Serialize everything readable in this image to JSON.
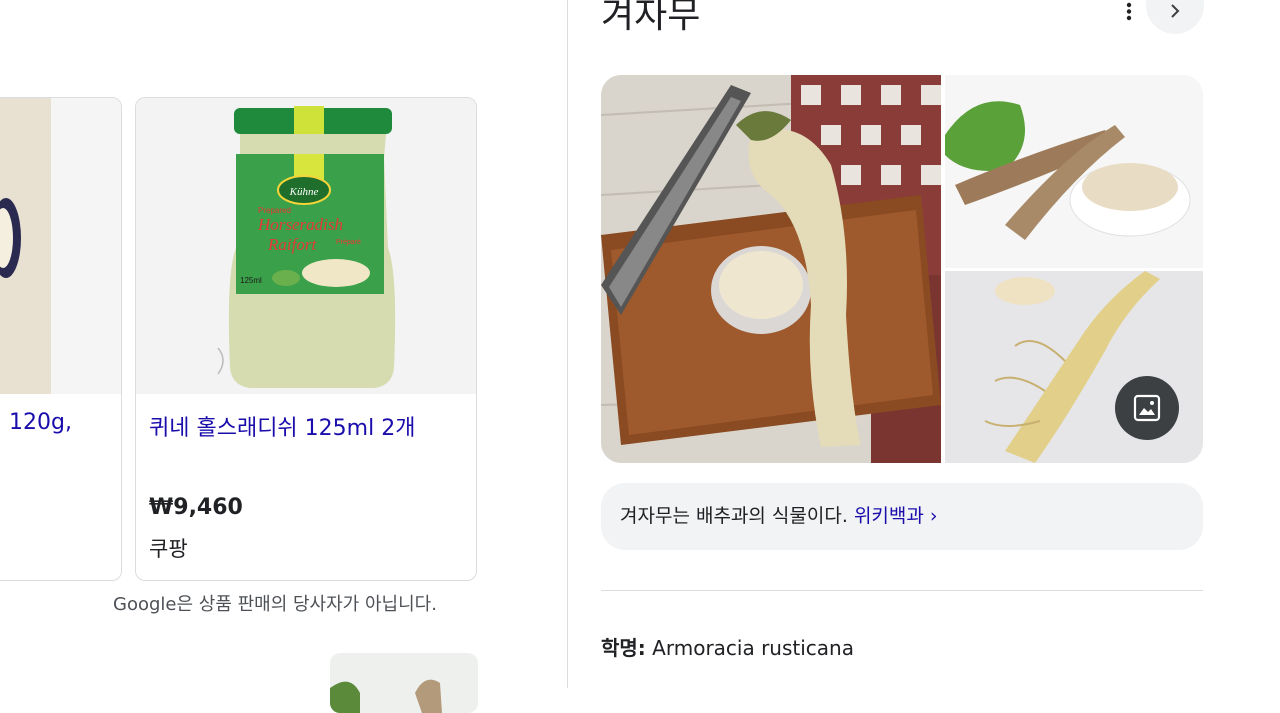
{
  "shopping": {
    "prev_card": {
      "title": "120g,"
    },
    "main_card": {
      "title": "퀴네 홀스래디쉬 125ml 2개",
      "price": "₩9,460",
      "seller": "쿠팡",
      "jar_label": {
        "brand": "Kühne",
        "line1": "Prepared",
        "line2": "Horseradish",
        "line3": "Raifort",
        "line4": "Préparé",
        "volume": "125ml"
      }
    },
    "disclaimer": "Google은 상품 판매의 당사자가 아닙니다."
  },
  "knowledge_panel": {
    "title": "겨자무",
    "more_icon": "more-vert-icon",
    "next_icon": "chevron-right-icon",
    "images_icon": "image-icon",
    "description": "겨자무는 배추과의 식물이다.",
    "wiki_link": "위키백과 ›",
    "sci_label": "학명:",
    "sci_value": "Armoracia rusticana"
  },
  "colors": {
    "link": "#1a0dab",
    "chip_bg": "#f1f3f4",
    "border": "#dadce0"
  }
}
